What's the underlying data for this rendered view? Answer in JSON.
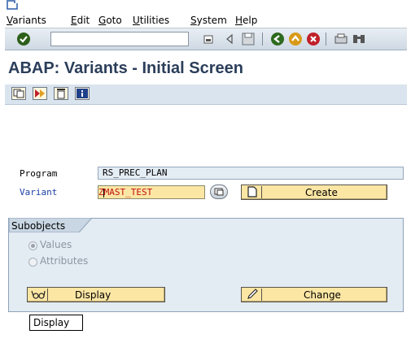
{
  "menubar": {
    "items": [
      {
        "label": "Variants"
      },
      {
        "label": "Edit"
      },
      {
        "label": "Goto"
      },
      {
        "label": "Utilities"
      },
      {
        "label": "System"
      },
      {
        "label": "Help"
      }
    ]
  },
  "toolbar": {
    "command_field_value": "",
    "icons": [
      "enter-icon",
      "command-dropdown-icon",
      "back-arrow-icon",
      "save-icon",
      "back-icon",
      "exit-icon",
      "cancel-icon",
      "print-icon",
      "find-icon"
    ]
  },
  "title": "ABAP: Variants - Initial Screen",
  "app_toolbar": {
    "icons": [
      "copy-icon",
      "display-variant-icon",
      "delete-icon",
      "info-icon"
    ]
  },
  "form": {
    "program_label": "Program",
    "program_value": "RS_PREC_PLAN",
    "variant_label": "Variant",
    "variant_value": "ZMAST_TEST",
    "create_label": "Create"
  },
  "subobjects": {
    "title": "Subobjects",
    "options": [
      {
        "label": "Values",
        "checked": true
      },
      {
        "label": "Attributes",
        "checked": false
      }
    ],
    "display_label": "Display",
    "change_label": "Change"
  },
  "tooltip": "Display",
  "colors": {
    "title": "#2b3e5a",
    "variant_label": "#1a3fa8",
    "variant_text": "#c01010",
    "button_bg": "#fbe6a4",
    "group_bg": "#e3ebf3"
  }
}
